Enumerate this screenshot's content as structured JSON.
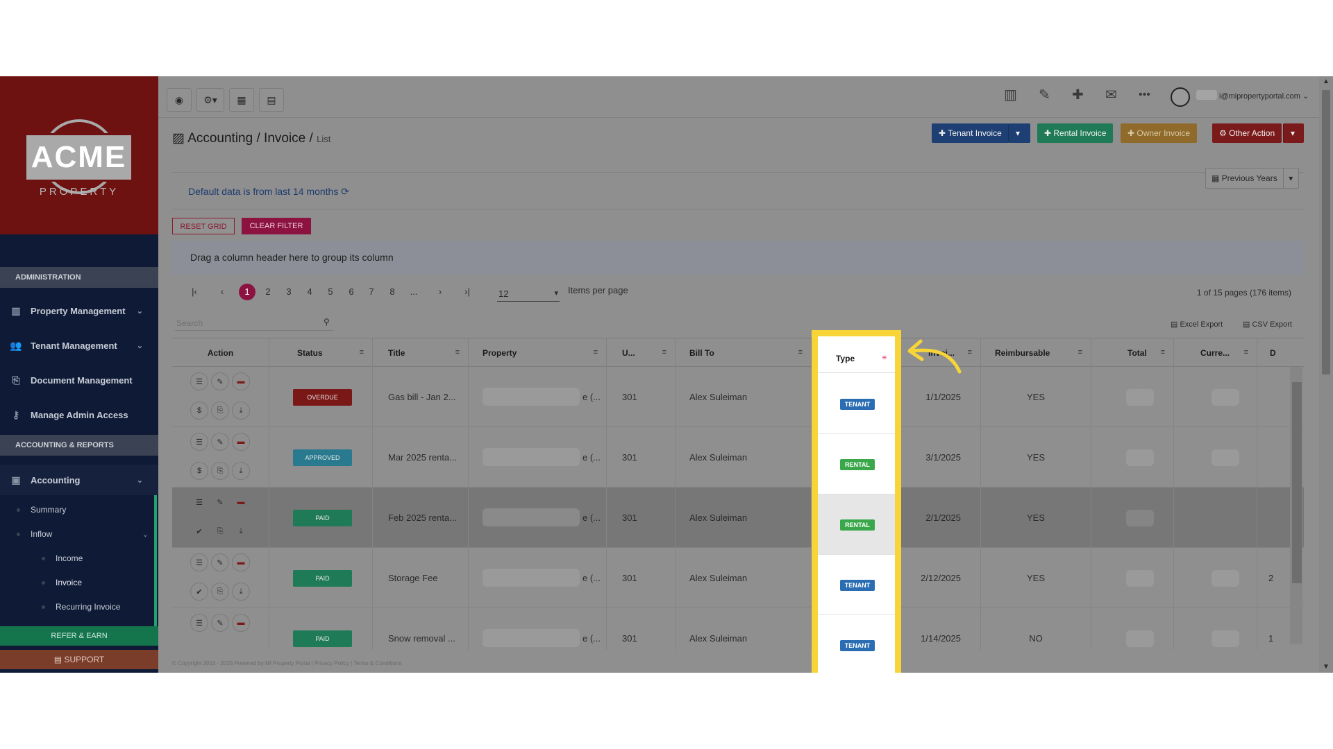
{
  "sidebar": {
    "logo_text": "ACME",
    "logo_sub": "PROPERTY",
    "sections": [
      "ADMINISTRATION",
      "ACCOUNTING & REPORTS"
    ],
    "admin_items": [
      {
        "label": "Property Management",
        "icon": "building-icon"
      },
      {
        "label": "Tenant Management",
        "icon": "users-icon"
      },
      {
        "label": "Document Management",
        "icon": "documents-icon"
      },
      {
        "label": "Manage Admin Access",
        "icon": "key-icon"
      }
    ],
    "accounting": {
      "label": "Accounting",
      "icon": "money-icon"
    },
    "sub_items": [
      "Summary",
      "Inflow"
    ],
    "inflow_items": [
      "Income",
      "Invoice",
      "Recurring Invoice"
    ],
    "refer_label": "REFER & EARN",
    "support_label": "SUPPORT"
  },
  "topbar": {
    "user_email": "i@mipropertyportal.com"
  },
  "header": {
    "breadcrumb_1": "Accounting",
    "sep_1": "/",
    "breadcrumb_2": "Invoice",
    "sep_2": "/",
    "breadcrumb_3": "List",
    "buttons": {
      "tenant_invoice": "Tenant Invoice",
      "rental_invoice": "Rental Invoice",
      "owner_invoice": "Owner Invoice",
      "other_action": "Other Action"
    }
  },
  "info": {
    "text": "Default data is from last 14 months",
    "previous_years": "Previous Years"
  },
  "filters": {
    "reset_grid": "RESET GRID",
    "clear_filter": "CLEAR FILTER"
  },
  "group_bar": "Drag a column header here to group its column",
  "pager": {
    "pages": [
      "1",
      "2",
      "3",
      "4",
      "5",
      "6",
      "7",
      "8",
      "..."
    ],
    "current_page": "1",
    "per_page": "12",
    "per_page_label": "Items per page",
    "summary": "1 of 15 pages (176 items)"
  },
  "search": {
    "placeholder": "Search"
  },
  "exports": {
    "excel": "Excel Export",
    "csv": "CSV Export"
  },
  "columns": [
    "Action",
    "Status",
    "Title",
    "Property",
    "U...",
    "Bill To",
    "Type",
    "Invoi...",
    "Reimbursable",
    "Total",
    "Curre...",
    "D"
  ],
  "rows": [
    {
      "status": "OVERDUE",
      "status_color": "#7a1717",
      "title": "Gas bill - Jan 2...",
      "property_tail": "e (...",
      "unit": "301",
      "bill_to": "Alex Suleiman",
      "type": "TENANT",
      "date": "1/1/2025",
      "reimbursable": "YES",
      "trail": ""
    },
    {
      "status": "APPROVED",
      "status_color": "#2a7a8f",
      "title": "Mar 2025 renta...",
      "property_tail": "e (...",
      "unit": "301",
      "bill_to": "Alex Suleiman",
      "type": "RENTAL",
      "date": "3/1/2025",
      "reimbursable": "YES",
      "trail": ""
    },
    {
      "status": "PAID",
      "status_color": "#1f7a57",
      "title": "Feb 2025 renta...",
      "property_tail": "e (...",
      "unit": "301",
      "bill_to": "Alex Suleiman",
      "type": "RENTAL",
      "date": "2/1/2025",
      "reimbursable": "YES",
      "trail": ""
    },
    {
      "status": "PAID",
      "status_color": "#1f7a57",
      "title": "Storage Fee",
      "property_tail": "e (...",
      "unit": "301",
      "bill_to": "Alex Suleiman",
      "type": "TENANT",
      "date": "2/12/2025",
      "reimbursable": "YES",
      "trail": "2"
    },
    {
      "status": "PAID",
      "status_color": "#1f7a57",
      "title": "Snow removal ...",
      "property_tail": "e (...",
      "unit": "301",
      "bill_to": "Alex Suleiman",
      "type": "TENANT",
      "date": "1/14/2025",
      "reimbursable": "NO",
      "trail": "1"
    }
  ],
  "type_colors": {
    "TENANT": "#2a6db3",
    "RENTAL": "#3aa84a"
  },
  "accent": "#f7d538",
  "footer": "© Copyright 2015 - 2025 Powered by MI Property Portal | Privacy Policy | Terms & Conditions"
}
